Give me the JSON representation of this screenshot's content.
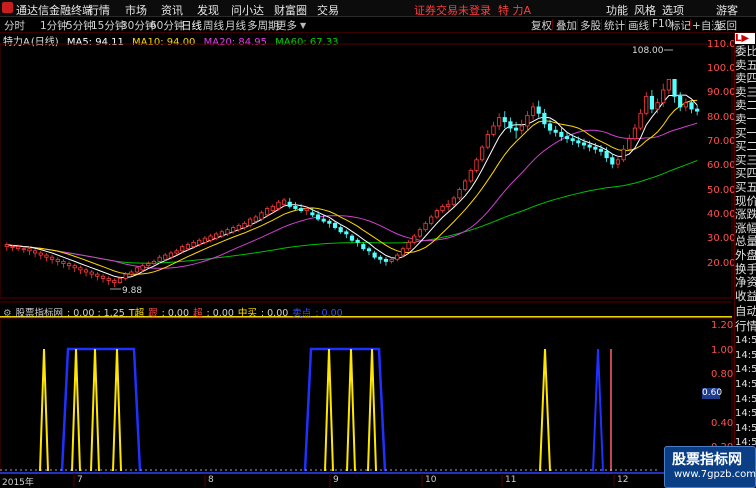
{
  "titlebar": {
    "app_title": "通达信金融终端",
    "menus": [
      "行情",
      "市场",
      "资讯",
      "发现",
      "问小达",
      "财富圈",
      "交易"
    ],
    "status": "证券交易未登录",
    "stock": "特 力A",
    "right": [
      "功能",
      "风格",
      "选项"
    ],
    "guest": "游客"
  },
  "periods": [
    "分时",
    "1分钟",
    "5分钟",
    "15分钟",
    "30分钟",
    "60分钟",
    "日线",
    "周线",
    "月线",
    "多周期",
    "更多"
  ],
  "active_period": "日线",
  "tools": [
    "复权",
    "叠加",
    "多股",
    "统计",
    "画线",
    "F10",
    "标记",
    "自选",
    "返回"
  ],
  "info": {
    "stock": "特力A",
    "cycle": "(日线)",
    "ma5": "MA5: 94.11",
    "ma10": "MA10: 94.00",
    "ma20": "MA20: 84.95",
    "ma60": "MA60: 67.33",
    "colors": {
      "ma5": "#ffffff",
      "ma10": "#ffd700",
      "ma20": "#e040e0",
      "ma60": "#00d000"
    }
  },
  "price_axis": [
    "110.00",
    "100.00",
    "90.00",
    "80.00",
    "70.00",
    "60.00",
    "50.00",
    "40.00",
    "30.00",
    "20.00"
  ],
  "annotations": {
    "high": "108.00",
    "low": "9.88"
  },
  "indicator": {
    "name": "股票指标网",
    "values": ": 0.00 : 1.25",
    "t": "T超",
    "t2": "跟",
    "v1": ": 0.00",
    "label_red": "超",
    "v2": ": 0.00",
    "label_mid": "中买",
    "v3": ": 0.00",
    "label_blue": "卖点",
    "v4": ": 0.00"
  },
  "indicator_axis": [
    "1.20",
    "1.00",
    "0.80",
    "0.60",
    "0.40",
    "0.20"
  ],
  "highlight_value": "0.60",
  "months": [
    "2015年",
    "7",
    "8",
    "9",
    "10",
    "11",
    "12"
  ],
  "right_panel_top": [
    "L",
    "委比",
    "卖五",
    "卖四",
    "卖三",
    "卖二",
    "卖一",
    "买一",
    "买二",
    "买三",
    "买四",
    "买五",
    "现价",
    "涨跌",
    "涨幅",
    "总量",
    "外盘",
    "换手",
    "净资",
    "收益"
  ],
  "right_panel_bottom": [
    "自动",
    "行情",
    "14:50",
    "14:50",
    "14:50",
    "14:50",
    "14:50",
    "14:50",
    "14:50",
    "14:50",
    "14:50",
    "14:50"
  ],
  "watermark": {
    "line1": "股票指标网",
    "line2": "www.7gpzb.com"
  },
  "chart_data": {
    "type": "candlestick",
    "ylim": [
      5,
      115
    ],
    "candles": [
      [
        29,
        30,
        27,
        31
      ],
      [
        29,
        29,
        27,
        30
      ],
      [
        28,
        29,
        27,
        30
      ],
      [
        28,
        28,
        26,
        29
      ],
      [
        27,
        28,
        25,
        29
      ],
      [
        26,
        27,
        24,
        28
      ],
      [
        25,
        26,
        23,
        27
      ],
      [
        24,
        25,
        22,
        26
      ],
      [
        23,
        24,
        21,
        25
      ],
      [
        22,
        23,
        20,
        24
      ],
      [
        21,
        22,
        19,
        23
      ],
      [
        20,
        21,
        18,
        22
      ],
      [
        19,
        20,
        17,
        21
      ],
      [
        18,
        19,
        16,
        20
      ],
      [
        17,
        18,
        15,
        19
      ],
      [
        16,
        17,
        14,
        18
      ],
      [
        15,
        16,
        13,
        17
      ],
      [
        14,
        15,
        12,
        16
      ],
      [
        13,
        14,
        11,
        15
      ],
      [
        12,
        13,
        9.88,
        14
      ],
      [
        12,
        14,
        11.5,
        15
      ],
      [
        14,
        16,
        13,
        17
      ],
      [
        16,
        17,
        15,
        18
      ],
      [
        17,
        19,
        16,
        20
      ],
      [
        18,
        20,
        17,
        21
      ],
      [
        20,
        21,
        19,
        22
      ],
      [
        21,
        22,
        20,
        23
      ],
      [
        22,
        24,
        21,
        25
      ],
      [
        23,
        25,
        22,
        26
      ],
      [
        24,
        26,
        23,
        27
      ],
      [
        26,
        27,
        25,
        28
      ],
      [
        27,
        29,
        26,
        30
      ],
      [
        28,
        30,
        27,
        31
      ],
      [
        29,
        31,
        28,
        32
      ],
      [
        30,
        32,
        29,
        33
      ],
      [
        31,
        33,
        30,
        34
      ],
      [
        32,
        34,
        31,
        35
      ],
      [
        33,
        35,
        32,
        36
      ],
      [
        34,
        36,
        33,
        37
      ],
      [
        35,
        37,
        34,
        38
      ],
      [
        36,
        38,
        35,
        39
      ],
      [
        37,
        39,
        36,
        40
      ],
      [
        38,
        40,
        37,
        41
      ],
      [
        39,
        42,
        38,
        43
      ],
      [
        41,
        43,
        40,
        44
      ],
      [
        42,
        45,
        41,
        46
      ],
      [
        44,
        47,
        43,
        48
      ],
      [
        46,
        48,
        45,
        49
      ],
      [
        47,
        50,
        46,
        51
      ],
      [
        49,
        51,
        48,
        52
      ],
      [
        50,
        48,
        47,
        52
      ],
      [
        48,
        47,
        46,
        50
      ],
      [
        47,
        46,
        45,
        49
      ],
      [
        46,
        47,
        44,
        48
      ],
      [
        45,
        44,
        43,
        47
      ],
      [
        44,
        42,
        41,
        46
      ],
      [
        42,
        41,
        40,
        44
      ],
      [
        41,
        40,
        38,
        42
      ],
      [
        40,
        38,
        37,
        41
      ],
      [
        38,
        36,
        35,
        39
      ],
      [
        36,
        35,
        33,
        37
      ],
      [
        34,
        32,
        31,
        35
      ],
      [
        32,
        31,
        29,
        33
      ],
      [
        30,
        28,
        27,
        31
      ],
      [
        28,
        27,
        25,
        29
      ],
      [
        26,
        24,
        23,
        27
      ],
      [
        24,
        23,
        21,
        25
      ],
      [
        23,
        22,
        20,
        24
      ],
      [
        22,
        23,
        21,
        24
      ],
      [
        23,
        25,
        22,
        26
      ],
      [
        25,
        28,
        24,
        29
      ],
      [
        28,
        31,
        27,
        32
      ],
      [
        31,
        34,
        30,
        35
      ],
      [
        34,
        37,
        33,
        38
      ],
      [
        37,
        40,
        36,
        41
      ],
      [
        40,
        43,
        39,
        44
      ],
      [
        43,
        46,
        42,
        47
      ],
      [
        46,
        48,
        45,
        49
      ],
      [
        48,
        49,
        46,
        51
      ],
      [
        49,
        52,
        48,
        53
      ],
      [
        52,
        56,
        51,
        57
      ],
      [
        56,
        60,
        55,
        61
      ],
      [
        60,
        65,
        59,
        66
      ],
      [
        65,
        70,
        64,
        71
      ],
      [
        70,
        76,
        69,
        77
      ],
      [
        76,
        82,
        75,
        84
      ],
      [
        82,
        86,
        81,
        88
      ],
      [
        86,
        90,
        84,
        92
      ],
      [
        90,
        88,
        85,
        93
      ],
      [
        88,
        85,
        83,
        90
      ],
      [
        85,
        84,
        80,
        88
      ],
      [
        84,
        86,
        82,
        89
      ],
      [
        86,
        91,
        84,
        93
      ],
      [
        91,
        95,
        89,
        97
      ],
      [
        95,
        92,
        90,
        98
      ],
      [
        92,
        87,
        85,
        94
      ],
      [
        87,
        84,
        82,
        89
      ],
      [
        84,
        83,
        81,
        86
      ],
      [
        83,
        81,
        79,
        85
      ],
      [
        81,
        80,
        78,
        83
      ],
      [
        80,
        79,
        77,
        82
      ],
      [
        79,
        78,
        76,
        81
      ],
      [
        78,
        77,
        75,
        80
      ],
      [
        77,
        76,
        74,
        79
      ],
      [
        76,
        75,
        73,
        78
      ],
      [
        75,
        74,
        72,
        77
      ],
      [
        74,
        71,
        69,
        76
      ],
      [
        71,
        68,
        66,
        73
      ],
      [
        68,
        70,
        66,
        72
      ],
      [
        70,
        75,
        69,
        77
      ],
      [
        75,
        80,
        74,
        82
      ],
      [
        80,
        85,
        79,
        87
      ],
      [
        85,
        92,
        84,
        94
      ],
      [
        92,
        100,
        91,
        102
      ],
      [
        100,
        94,
        92,
        103
      ],
      [
        94,
        97,
        92,
        99
      ],
      [
        97,
        103,
        95,
        106
      ],
      [
        103,
        108,
        101,
        108
      ],
      [
        108,
        100,
        97,
        108
      ],
      [
        100,
        95,
        93,
        102
      ],
      [
        95,
        97,
        93,
        99
      ],
      [
        97,
        94,
        92,
        98
      ],
      [
        94,
        93,
        91,
        96
      ]
    ]
  }
}
